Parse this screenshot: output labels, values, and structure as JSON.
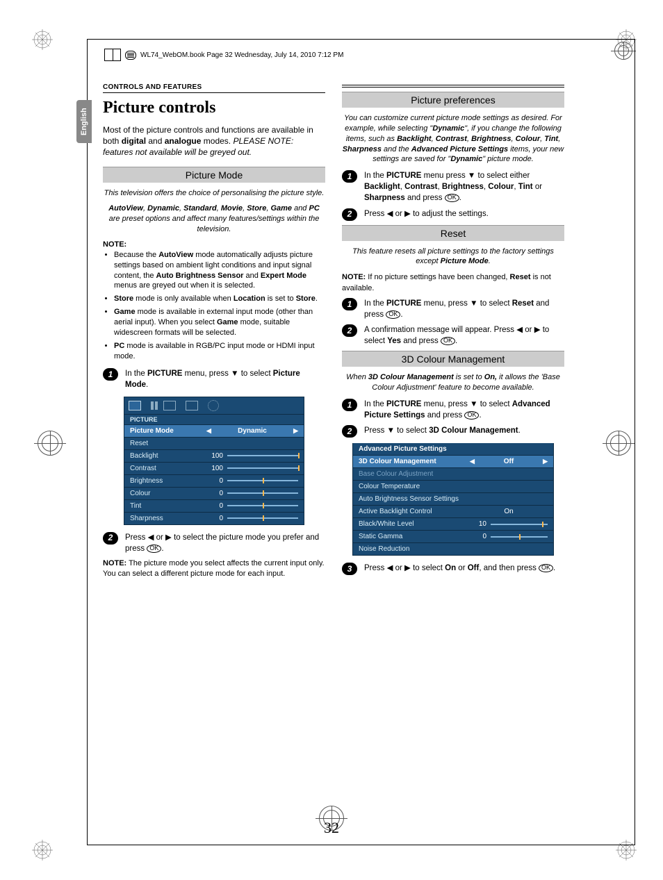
{
  "meta": {
    "header_line": "WL74_WebOM.book  Page 32  Wednesday, July 14, 2010  7:12 PM",
    "section_header": "CONTROLS AND FEATURES",
    "language_tab": "English",
    "page_number": "32"
  },
  "left": {
    "title": "Picture controls",
    "intro_html": "Most of the picture controls and functions are available in both <b>digital</b> and <b>analogue</b> modes. <i>PLEASE NOTE: features not available will be greyed out.</i>",
    "mode": {
      "heading": "Picture Mode",
      "sub1": "This television offers the choice of personalising the picture style.",
      "sub2_html": "<b>AutoView</b>, <b>Dynamic</b>, <b>Standard</b>, <b>Movie</b>, <b>Store</b>, <b>Game</b> and <b>PC</b> are preset options and affect many features/settings within the television.",
      "note_label": "NOTE:",
      "notes": [
        "Because the <b>AutoView</b> mode automatically adjusts picture settings based on ambient light conditions and input signal content, the <b>Auto Brightness Sensor</b> and <b>Expert Mode</b> menus are greyed out when it is selected.",
        "<b>Store</b> mode is only available when <b>Location</b> is set to <b>Store</b>.",
        "<b>Game</b> mode is available in external input mode (other than aerial input). When you select <b>Game</b> mode, suitable widescreen formats will be selected.",
        "<b>PC</b> mode is available in RGB/PC input mode or HDMI input mode."
      ],
      "step1_html": "In the <b>PICTURE</b> menu, press ▼ to select <b>Picture Mode</b>.",
      "step2_html": "Press ◀ or ▶ to select the picture mode you prefer and press <span class='ok-btn'>OK</span>.",
      "footer_note_html": "<b>NOTE:</b> The picture mode you select affects the current input only. You can select a different picture mode for each input."
    },
    "osd_picture": {
      "title": "PICTURE",
      "rows": [
        {
          "label": "Picture Mode",
          "type": "picker",
          "value": "Dynamic",
          "selected": true
        },
        {
          "label": "Reset",
          "type": "plain"
        },
        {
          "label": "Backlight",
          "type": "slider",
          "value": "100",
          "knob": 100
        },
        {
          "label": "Contrast",
          "type": "slider",
          "value": "100",
          "knob": 100
        },
        {
          "label": "Brightness",
          "type": "slider",
          "value": "0",
          "knob": 50
        },
        {
          "label": "Colour",
          "type": "slider",
          "value": "0",
          "knob": 50
        },
        {
          "label": "Tint",
          "type": "slider",
          "value": "0",
          "knob": 50
        },
        {
          "label": "Sharpness",
          "type": "slider",
          "value": "0",
          "knob": 50
        }
      ]
    }
  },
  "right": {
    "prefs": {
      "heading": "Picture preferences",
      "intro_html": "You can customize current picture mode settings as desired. For example, while selecting \"<b>Dynamic</b>\", if you change the following items, such as <b>Backlight</b>, <b>Contrast</b>, <b>Brightness</b>, <b>Colour</b>, <b>Tint</b>, <b>Sharpness</b> and the <b>Advanced Picture Settings</b> items, your new settings are saved for \"<b>Dynamic</b>\" picture mode.",
      "step1_html": "In the <b>PICTURE</b> menu press ▼ to select either <b>Backlight</b>, <b>Contrast</b>, <b>Brightness</b>, <b>Colour</b>, <b>Tint</b> or <b>Sharpness</b> and press <span class='ok-btn'>OK</span>.",
      "step2_html": "Press ◀ or ▶ to adjust the settings."
    },
    "reset": {
      "heading": "Reset",
      "intro_html": "This feature resets all picture settings to the factory settings except <b>Picture Mode</b>.",
      "note_html": "<b>NOTE:</b> If no picture settings have been changed, <b>Reset</b> is not available.",
      "step1_html": "In the <b>PICTURE</b> menu, press ▼ to select <b>Reset</b> and press <span class='ok-btn'>OK</span>.",
      "step2_html": "A confirmation message will appear. Press ◀ or ▶ to select <b>Yes</b> and press <span class='ok-btn'>OK</span>."
    },
    "cm3d": {
      "heading": "3D Colour Management",
      "intro_html": "When <b>3D Colour Management</b> is set to <b>On,</b> it allows the 'Base Colour Adjustment' feature to become available.",
      "step1_html": "In the <b>PICTURE</b> menu, press ▼ to select <b>Advanced Picture Settings</b> and press <span class='ok-btn'>OK</span>.",
      "step2_html": "Press ▼ to select <b>3D Colour Management</b>.",
      "step3_html": "Press ◀ or ▶ to select <b>On</b> or <b>Off</b>, and then press <span class='ok-btn'>OK</span>."
    },
    "osd_adv": {
      "title": "Advanced Picture Settings",
      "rows": [
        {
          "label": "3D Colour Management",
          "type": "picker",
          "value": "Off",
          "selected": true
        },
        {
          "label": "Base Colour Adjustment",
          "type": "plain",
          "grey": true
        },
        {
          "label": "Colour Temperature",
          "type": "plain"
        },
        {
          "label": "Auto Brightness Sensor Settings",
          "type": "plain"
        },
        {
          "label": "Active Backlight Control",
          "type": "text",
          "value": "On"
        },
        {
          "label": "Black/White Level",
          "type": "slider",
          "value": "10",
          "knob": 90
        },
        {
          "label": "Static Gamma",
          "type": "slider",
          "value": "0",
          "knob": 50
        },
        {
          "label": "Noise Reduction",
          "type": "plain"
        }
      ]
    }
  }
}
